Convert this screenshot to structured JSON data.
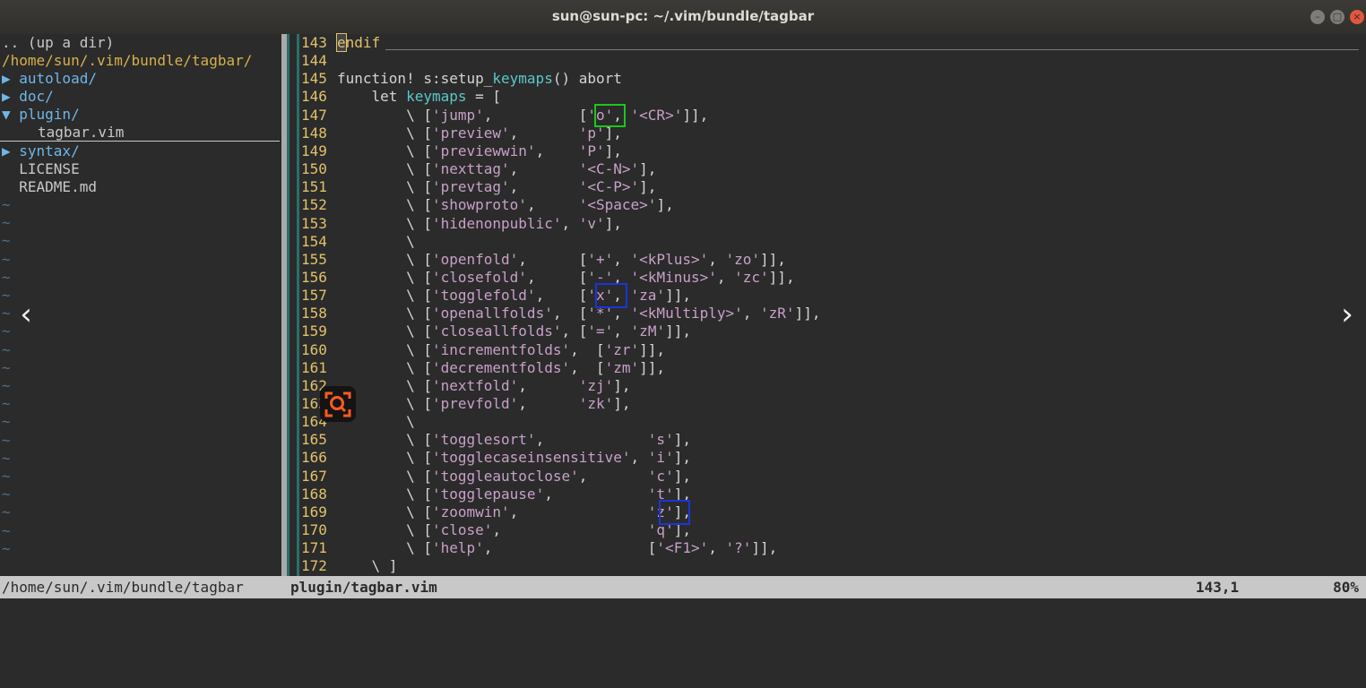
{
  "window": {
    "title": "sun@sun-pc: ~/.vim/bundle/tagbar",
    "buttons": [
      "–",
      "□",
      "×"
    ]
  },
  "tree": {
    "lines": [
      ".. (up a dir)",
      "/home/sun/.vim/bundle/tagbar/",
      "▶ autoload/",
      "▶ doc/",
      "▼ plugin/",
      "tagbar.vim",
      "▶ syntax/",
      "  LICENSE",
      "  README.md"
    ],
    "tilde": "~"
  },
  "code": {
    "line_numbers": [
      "143",
      "144",
      "145",
      "146",
      "147",
      "148",
      "149",
      "150",
      "151",
      "152",
      "153",
      "154",
      "155",
      "156",
      "157",
      "158",
      "159",
      "160",
      "161",
      "162",
      "163",
      "164",
      "165",
      "166",
      "167",
      "168",
      "169",
      "170",
      "171",
      "172"
    ],
    "lines": [
      "endif",
      "",
      "function! s:setup_keymaps() abort",
      "    let keymaps = [",
      "        \\ ['jump',          ['o', '<CR>']],",
      "        \\ ['preview',       'p'],",
      "        \\ ['previewwin',    'P'],",
      "        \\ ['nexttag',       '<C-N>'],",
      "        \\ ['prevtag',       '<C-P>'],",
      "        \\ ['showproto',     '<Space>'],",
      "        \\ ['hidenonpublic', 'v'],",
      "        \\",
      "        \\ ['openfold',      ['+', '<kPlus>', 'zo']],",
      "        \\ ['closefold',     ['-', '<kMinus>', 'zc']],",
      "        \\ ['togglefold',    ['x', 'za']],",
      "        \\ ['openallfolds',  ['*', '<kMultiply>', 'zR']],",
      "        \\ ['closeallfolds', ['=', 'zM']],",
      "        \\ ['incrementfolds',  ['zr']],",
      "        \\ ['decrementfolds',  ['zm']],",
      "        \\ ['nextfold',      'zj'],",
      "        \\ ['prevfold',      'zk'],",
      "        \\",
      "        \\ ['togglesort',            's'],",
      "        \\ ['togglecaseinsensitive', 'i'],",
      "        \\ ['toggleautoclose',       'c'],",
      "        \\ ['togglepause',           't'],",
      "        \\ ['zoomwin',               'z'],",
      "        \\ ['close',                 'q'],",
      "        \\ ['help',                  ['<F1>', '?']],",
      "    \\ ]"
    ]
  },
  "status": {
    "left": "/home/sun/.vim/bundle/tagbar",
    "file": "plugin/tagbar.vim",
    "position": "143,1",
    "percent": "80%"
  },
  "nav": {
    "prev": "‹",
    "next": "›"
  },
  "icons": {
    "lens": "search-lens-icon"
  }
}
